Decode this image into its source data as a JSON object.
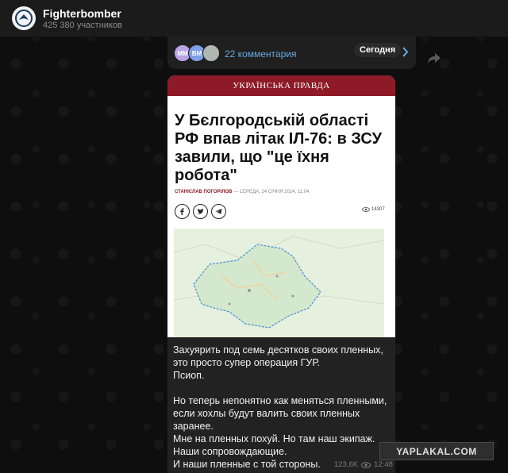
{
  "channel": {
    "name": "Fighterbomber",
    "members": "425 380 участников"
  },
  "comments_bar": {
    "avatars": [
      "MM",
      "BM",
      ""
    ],
    "label": "22 комментария",
    "date_badge": "Сегодня"
  },
  "article": {
    "brand": "УКРАЇНСЬКА ПРАВДА",
    "headline": "У Бєлгородській області РФ впав літак ІЛ-76: в ЗСУ завили, що \"це їхня робота\"",
    "author": "СТАНІСЛАВ ПОГОРІЛОВ",
    "dateline": " — СЕРЕДА, 24 СІЧНЯ 2024, 11:04",
    "views": "14307"
  },
  "message": {
    "paragraphs": [
      "Захуярить под семь десятков своих пленных, это просто супер операция ГУР.",
      "Псиоп.",
      "",
      "Но теперь непонятно как меняться пленными, если хохлы будут валить своих пленных заранее.",
      "Мне на пленных похуй. Но там наш экипаж.",
      "Наши сопровождающие.",
      "И наши пленные с той стороны."
    ],
    "views": "123,6K",
    "time": "12:48"
  },
  "watermark": "YAPLAKAL.COM",
  "colors": {
    "background": "#0e0e0e",
    "bubble": "#222222",
    "link": "#69a9e0",
    "brand_red": "#8e1a27"
  }
}
